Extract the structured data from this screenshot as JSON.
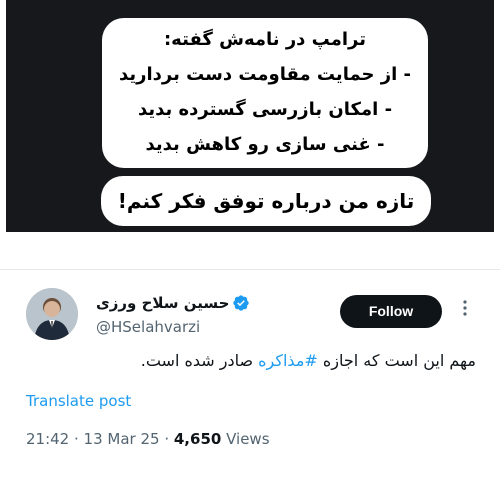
{
  "image_text": {
    "box1_lines": [
      "ترامپ در نامه‌ش گفته:",
      "- از حمایت مقاومت دست بردارید",
      "- امکان بازرسی گسترده بدید",
      "- غنی سازی رو کاهش بدید"
    ],
    "box2_line": "تازه من درباره توفق فکر کنم!"
  },
  "author": {
    "name": "حسین سلاح ورزی",
    "handle": "@HSelahvarzi",
    "verified_icon": "verified-badge-icon"
  },
  "follow_label": "Follow",
  "post": {
    "text_before": "مهم این است که اجازه ",
    "hashtag": "#مذاکره",
    "text_after": " صادر شده است."
  },
  "translate_label": "Translate post",
  "meta": {
    "time": "21:42",
    "sep1": " · ",
    "date": "13 Mar 25",
    "sep2": " · ",
    "views": "4,650",
    "views_label": " Views"
  },
  "colors": {
    "link": "#1d9bf0",
    "button_bg": "#0f1419",
    "meme_bg": "#16181c",
    "muted": "#536471"
  }
}
